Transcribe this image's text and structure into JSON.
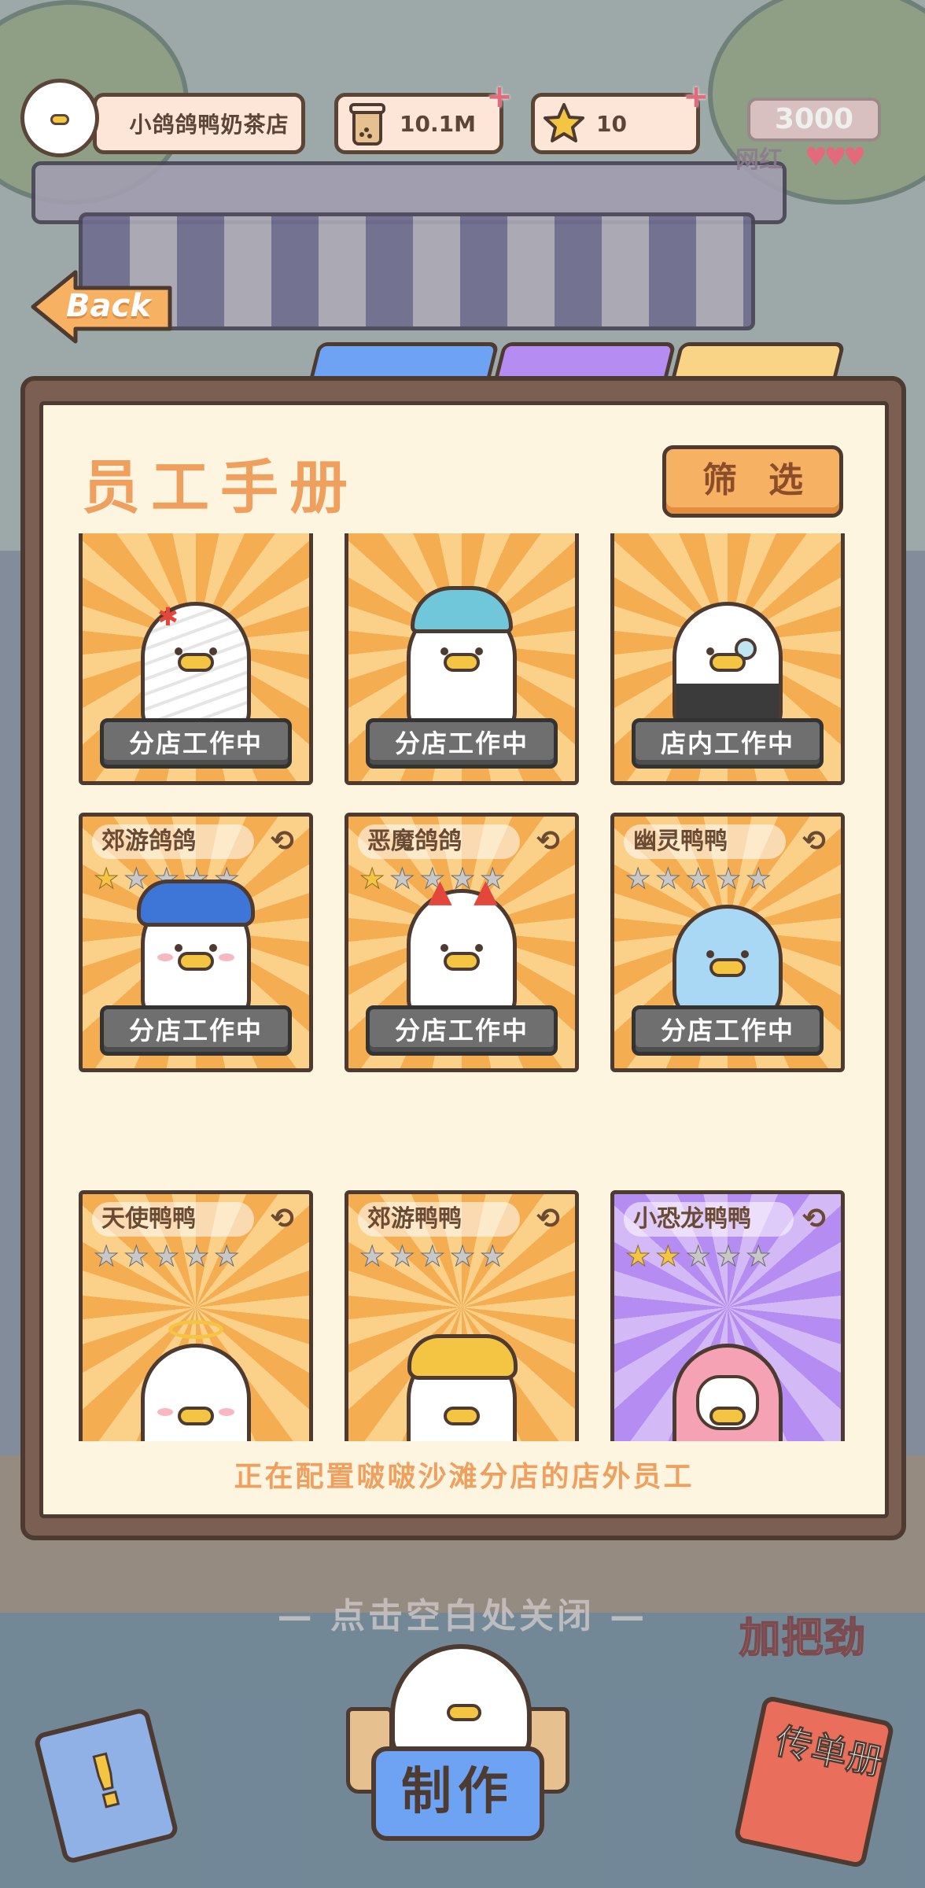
{
  "header": {
    "shop_name": "小鸽鸽鸭奶茶店",
    "milk_tea_amount": "10.1M",
    "star_amount": "10",
    "fans_count": "3000",
    "fans_label": "网红",
    "fans_hearts": "♥♥♥"
  },
  "back_button": {
    "label": "Back"
  },
  "manual": {
    "title": "员工手册",
    "filter_label": "筛选",
    "config_note": "正在配置啵啵沙滩分店的店外员工"
  },
  "cards": [
    {
      "name": "",
      "stars": [],
      "status": "分店工作中",
      "theme": "orange",
      "costume": "mummy"
    },
    {
      "name": "",
      "stars": [],
      "status": "分店工作中",
      "theme": "orange",
      "costume": "beach-hat"
    },
    {
      "name": "",
      "stars": [],
      "status": "店内工作中",
      "theme": "orange",
      "costume": "tuxedo"
    },
    {
      "name": "郊游鸽鸽",
      "stars": [
        1,
        0,
        0,
        0,
        0
      ],
      "status": "分店工作中",
      "theme": "orange",
      "costume": "bucket-hat"
    },
    {
      "name": "恶魔鸽鸽",
      "stars": [
        1,
        0,
        0,
        0,
        0
      ],
      "status": "分店工作中",
      "theme": "orange",
      "costume": "devil"
    },
    {
      "name": "幽灵鸭鸭",
      "stars": [
        0,
        0,
        0,
        0,
        0
      ],
      "status": "分店工作中",
      "theme": "orange",
      "costume": "ghost"
    },
    {
      "name": "天使鸭鸭",
      "stars": [
        0,
        0,
        0,
        0,
        0
      ],
      "status": "",
      "theme": "orange",
      "costume": "angel"
    },
    {
      "name": "郊游鸭鸭",
      "stars": [
        0,
        0,
        0,
        0,
        0
      ],
      "status": "",
      "theme": "orange",
      "costume": "yellow-hat"
    },
    {
      "name": "小恐龙鸭鸭",
      "stars": [
        1,
        1,
        0,
        0,
        0
      ],
      "status": "",
      "theme": "purple",
      "costume": "dino"
    }
  ],
  "footer": {
    "close_hint": "— 点击空白处关闭 —",
    "cheer_label": "加把劲",
    "make_label": "制作",
    "flyer_label": "传单册"
  },
  "colors": {
    "accent_orange": "#f0a05e",
    "frame_brown": "#4d3a30",
    "status_gray": "#6f6f6f",
    "tab_blue": "#6ea2f2",
    "tab_purple": "#b58cf2",
    "tab_yellow": "#f9d386"
  }
}
